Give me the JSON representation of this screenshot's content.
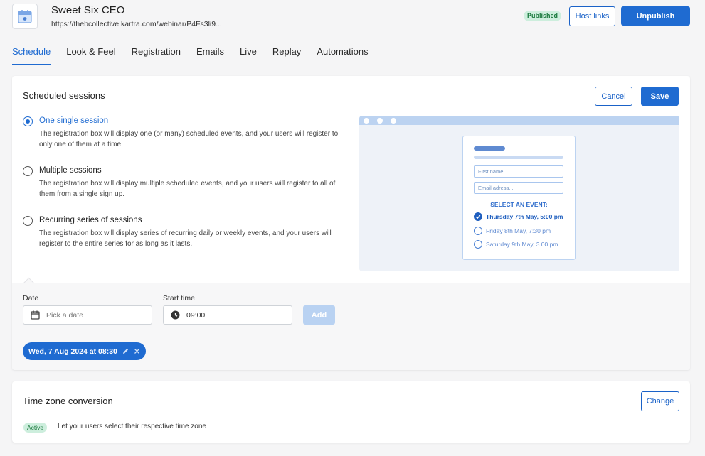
{
  "header": {
    "title": "Sweet Six CEO",
    "url": "https://thebcollective.kartra.com/webinar/P4Fs3li9...",
    "status_badge": "Published",
    "host_links_label": "Host links",
    "unpublish_label": "Unpublish",
    "icon": "calendar-icon"
  },
  "tabs": [
    {
      "label": "Schedule",
      "active": true
    },
    {
      "label": "Look & Feel",
      "active": false
    },
    {
      "label": "Registration",
      "active": false
    },
    {
      "label": "Emails",
      "active": false
    },
    {
      "label": "Live",
      "active": false
    },
    {
      "label": "Replay",
      "active": false
    },
    {
      "label": "Automations",
      "active": false
    }
  ],
  "scheduled": {
    "title": "Scheduled sessions",
    "cancel_label": "Cancel",
    "save_label": "Save",
    "options": [
      {
        "title": "One single session",
        "desc": "The registration box will display one (or many) scheduled events, and your users will register to only one of them at a time.",
        "checked": true
      },
      {
        "title": "Multiple sessions",
        "desc": "The registration box will display multiple scheduled events, and your users will register to all of them from a single sign up.",
        "checked": false
      },
      {
        "title": "Recurring series of sessions",
        "desc": "The registration box will display series of recurring daily or weekly events, and your users will register to the entire series for as long as it lasts.",
        "checked": false
      }
    ],
    "preview": {
      "first_name_placeholder": "First name...",
      "email_placeholder": "Email adress...",
      "select_event_label": "SELECT AN EVENT:",
      "events": [
        {
          "label": "Thursday 7th May, 5:00 pm",
          "selected": true
        },
        {
          "label": "Friday 8th May,  7:30 pm",
          "selected": false
        },
        {
          "label": "Saturday 9th May, 3.00 pm",
          "selected": false
        }
      ]
    },
    "date_label": "Date",
    "date_placeholder": "Pick a date",
    "start_time_label": "Start time",
    "start_time_value": "09:00",
    "add_label": "Add",
    "session_chip": "Wed, 7 Aug 2024 at 08:30"
  },
  "timezone": {
    "title": "Time zone conversion",
    "change_label": "Change",
    "status_badge": "Active",
    "desc": "Let your users select their respective time zone"
  },
  "colors": {
    "accent": "#1f6bd1",
    "badge_green_bg": "#cdeedd",
    "badge_green_text": "#1b7a3e",
    "add_disabled": "#b9d2f2"
  }
}
